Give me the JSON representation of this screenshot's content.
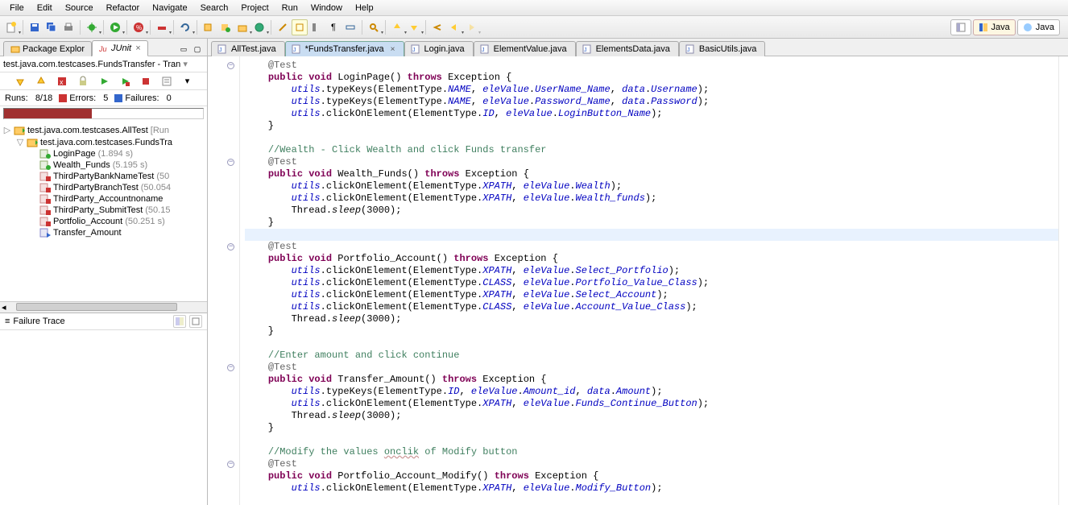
{
  "menu": {
    "file": "File",
    "edit": "Edit",
    "source": "Source",
    "refactor": "Refactor",
    "navigate": "Navigate",
    "search": "Search",
    "project": "Project",
    "run": "Run",
    "window": "Window",
    "help": "Help"
  },
  "persp": {
    "java": "Java",
    "other": "Java"
  },
  "left": {
    "tab_pkg": "Package Explor",
    "tab_junit": "JUnit",
    "title": "test.java.com.testcases.FundsTransfer - Tran",
    "runs_label": "Runs:",
    "runs": "8/18",
    "errors_label": "Errors:",
    "errors": "5",
    "fail_label": "Failures:",
    "fail": "0",
    "tree": [
      {
        "indent": 0,
        "exp": "▷",
        "icon": "suite",
        "label": "test.java.com.testcases.AllTest",
        "suf": "[Run"
      },
      {
        "indent": 1,
        "exp": "▽",
        "icon": "suite",
        "label": "test.java.com.testcases.FundsTra",
        "suf": ""
      },
      {
        "indent": 2,
        "exp": "",
        "icon": "pass",
        "label": "LoginPage",
        "suf": "(1.894 s)"
      },
      {
        "indent": 2,
        "exp": "",
        "icon": "pass",
        "label": "Wealth_Funds",
        "suf": "(5.195 s)"
      },
      {
        "indent": 2,
        "exp": "",
        "icon": "err",
        "label": "ThirdPartyBankNameTest",
        "suf": "(50"
      },
      {
        "indent": 2,
        "exp": "",
        "icon": "err",
        "label": "ThirdPartyBranchTest",
        "suf": "(50.054"
      },
      {
        "indent": 2,
        "exp": "",
        "icon": "err",
        "label": "ThirdParty_Accountnoname",
        "suf": ""
      },
      {
        "indent": 2,
        "exp": "",
        "icon": "err",
        "label": "ThirdParty_SubmitTest",
        "suf": "(50.15"
      },
      {
        "indent": 2,
        "exp": "",
        "icon": "err",
        "label": "Portfolio_Account",
        "suf": "(50.251 s)"
      },
      {
        "indent": 2,
        "exp": "",
        "icon": "run",
        "label": "Transfer_Amount",
        "suf": ""
      }
    ],
    "failtrace": "Failure Trace"
  },
  "tabs": [
    {
      "label": "AllTest.java"
    },
    {
      "label": "*FundsTransfer.java",
      "active": true
    },
    {
      "label": "Login.java"
    },
    {
      "label": "ElementValue.java"
    },
    {
      "label": "ElementsData.java"
    },
    {
      "label": "BasicUtils.java"
    }
  ],
  "code_lines": [
    {
      "fold": "c",
      "html": "    <span class='ann'>@Test</span>"
    },
    {
      "html": "    <span class='kw'>public</span> <span class='kw'>void</span> LoginPage() <span class='kw'>throws</span> Exception {"
    },
    {
      "html": "        <span class='fld'>utils</span>.typeKeys(ElementType.<span class='stat'>NAME</span>, <span class='fld'>eleValue</span>.<span class='fld'>UserName_Name</span>, <span class='fld'>data</span>.<span class='fld'>Username</span>);"
    },
    {
      "html": "        <span class='fld'>utils</span>.typeKeys(ElementType.<span class='stat'>NAME</span>, <span class='fld'>eleValue</span>.<span class='fld'>Password_Name</span>, <span class='fld'>data</span>.<span class='fld'>Password</span>);"
    },
    {
      "html": "        <span class='fld'>utils</span>.clickOnElement(ElementType.<span class='stat'>ID</span>, <span class='fld'>eleValue</span>.<span class='fld'>LoginButton_Name</span>);"
    },
    {
      "html": "    }"
    },
    {
      "html": ""
    },
    {
      "html": "    <span class='com'>//Wealth - Click Wealth and click Funds transfer</span>"
    },
    {
      "fold": "c",
      "html": "    <span class='ann'>@Test</span>"
    },
    {
      "html": "    <span class='kw'>public</span> <span class='kw'>void</span> Wealth_Funds() <span class='kw'>throws</span> Exception {"
    },
    {
      "html": "        <span class='fld'>utils</span>.clickOnElement(ElementType.<span class='stat'>XPATH</span>, <span class='fld'>eleValue</span>.<span class='fld'>Wealth</span>);"
    },
    {
      "html": "        <span class='fld'>utils</span>.clickOnElement(ElementType.<span class='stat'>XPATH</span>, <span class='fld'>eleValue</span>.<span class='fld'>Wealth_funds</span>);"
    },
    {
      "html": "        Thread.<span class='meth'>sleep</span>(3000);"
    },
    {
      "html": "    }"
    },
    {
      "hl": true,
      "html": "    "
    },
    {
      "fold": "c",
      "html": "    <span class='ann'>@Test</span>"
    },
    {
      "html": "    <span class='kw'>public</span> <span class='kw'>void</span> Portfolio_Account() <span class='kw'>throws</span> Exception {"
    },
    {
      "html": "        <span class='fld'>utils</span>.clickOnElement(ElementType.<span class='stat'>XPATH</span>, <span class='fld'>eleValue</span>.<span class='fld'>Select_Portfolio</span>);"
    },
    {
      "html": "        <span class='fld'>utils</span>.clickOnElement(ElementType.<span class='stat'>CLASS</span>, <span class='fld'>eleValue</span>.<span class='fld'>Portfolio_Value_Class</span>);"
    },
    {
      "html": "        <span class='fld'>utils</span>.clickOnElement(ElementType.<span class='stat'>XPATH</span>, <span class='fld'>eleValue</span>.<span class='fld'>Select_Account</span>);"
    },
    {
      "html": "        <span class='fld'>utils</span>.clickOnElement(ElementType.<span class='stat'>CLASS</span>, <span class='fld'>eleValue</span>.<span class='fld'>Account_Value_Class</span>);"
    },
    {
      "html": "        Thread.<span class='meth'>sleep</span>(3000);"
    },
    {
      "html": "    }"
    },
    {
      "html": ""
    },
    {
      "html": "    <span class='com'>//Enter amount and click continue</span>"
    },
    {
      "fold": "c",
      "html": "    <span class='ann'>@Test</span>"
    },
    {
      "html": "    <span class='kw'>public</span> <span class='kw'>void</span> Transfer_Amount() <span class='kw'>throws</span> Exception {"
    },
    {
      "html": "        <span class='fld'>utils</span>.typeKeys(ElementType.<span class='stat'>ID</span>, <span class='fld'>eleValue</span>.<span class='fld'>Amount_id</span>, <span class='fld'>data</span>.<span class='fld'>Amount</span>);"
    },
    {
      "html": "        <span class='fld'>utils</span>.clickOnElement(ElementType.<span class='stat'>XPATH</span>, <span class='fld'>eleValue</span>.<span class='fld'>Funds_Continue_Button</span>);"
    },
    {
      "html": "        Thread.<span class='meth'>sleep</span>(3000);"
    },
    {
      "html": "    }"
    },
    {
      "html": ""
    },
    {
      "html": "    <span class='com'>//Modify the values <span style='text-decoration:underline wavy #c99'>onclik</span> of Modify button</span>"
    },
    {
      "fold": "c",
      "html": "    <span class='ann'>@Test</span>"
    },
    {
      "html": "    <span class='kw'>public</span> <span class='kw'>void</span> Portfolio_Account_Modify() <span class='kw'>throws</span> Exception {"
    },
    {
      "html": "        <span class='fld'>utils</span>.clickOnElement(ElementType.<span class='stat'>XPATH</span>, <span class='fld'>eleValue</span>.<span class='fld'>Modify_Button</span>);"
    }
  ]
}
